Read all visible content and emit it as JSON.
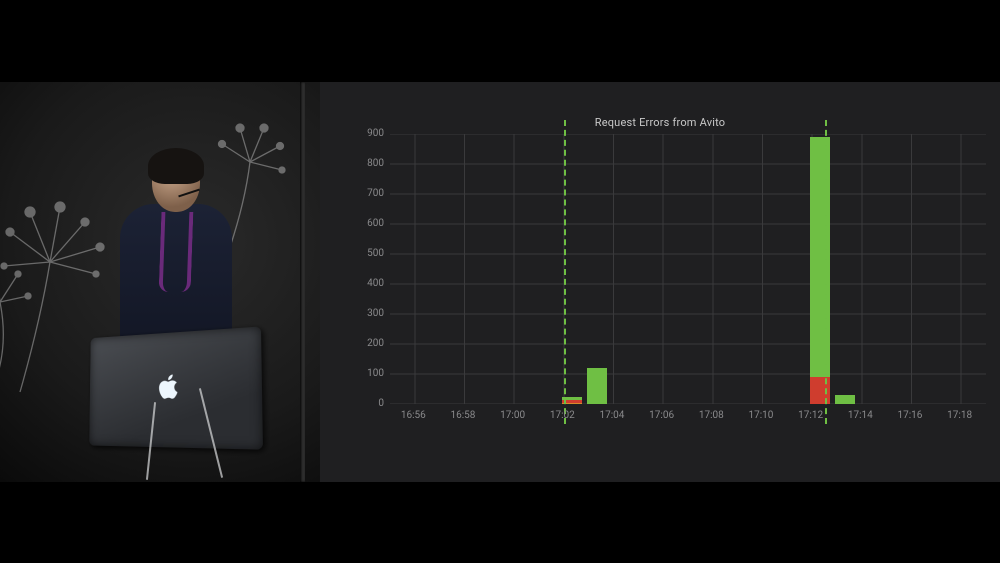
{
  "chart_data": {
    "type": "bar",
    "title": "Request Errors from Avito",
    "xlabel": "",
    "ylabel": "",
    "ylim": [
      0,
      900
    ],
    "y_ticks": [
      0,
      100,
      200,
      300,
      400,
      500,
      600,
      700,
      800,
      900
    ],
    "x_ticks": [
      "16:56",
      "16:58",
      "17:00",
      "17:02",
      "17:04",
      "17:06",
      "17:08",
      "17:10",
      "17:12",
      "17:14",
      "17:16",
      "17:18"
    ],
    "x_range": [
      "16:55",
      "17:19"
    ],
    "series_names": [
      "green",
      "red",
      "orange"
    ],
    "stacked": true,
    "bars": [
      {
        "time": "17:02",
        "green": 10,
        "red": 10,
        "orange": 5
      },
      {
        "time": "17:03",
        "green": 120,
        "red": 0,
        "orange": 0
      },
      {
        "time": "17:12",
        "green": 800,
        "red": 90,
        "orange": 0
      },
      {
        "time": "17:13",
        "green": 30,
        "red": 0,
        "orange": 0
      }
    ],
    "markers": [
      "17:02",
      "17:12.5"
    ]
  },
  "colors": {
    "panel_bg": "#1f1f21",
    "grid": "#3a3a3c",
    "text": "#8a8a8c",
    "green": "#6fbf44",
    "red": "#cf3d2e",
    "orange": "#d88a2a"
  }
}
